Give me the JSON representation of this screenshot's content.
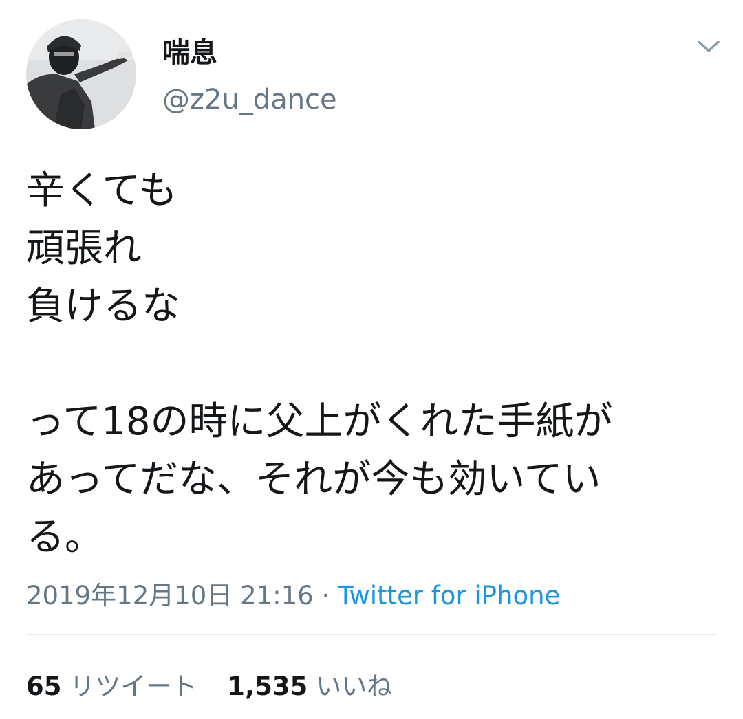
{
  "user": {
    "display_name": "喘息",
    "handle": "@z2u_dance",
    "avatar_icon": "profile-photo"
  },
  "menu": {
    "icon": "chevron-down-icon"
  },
  "tweet": {
    "lines": [
      "辛くても",
      "頑張れ",
      "負けるな",
      "",
      "って18の時に父上がくれた手紙が",
      "あってだな、それが今も効いてい",
      "る。"
    ]
  },
  "meta": {
    "timestamp": "2019年12月10日 21:16",
    "separator": "·",
    "source": "Twitter for iPhone"
  },
  "stats": {
    "retweets_count": "65",
    "retweets_label": "リツイート",
    "likes_count": "1,535",
    "likes_label": "いいね"
  },
  "colors": {
    "text_primary": "#14171a",
    "text_secondary": "#657786",
    "link": "#1b95e0",
    "divider": "#e6ecf0"
  }
}
